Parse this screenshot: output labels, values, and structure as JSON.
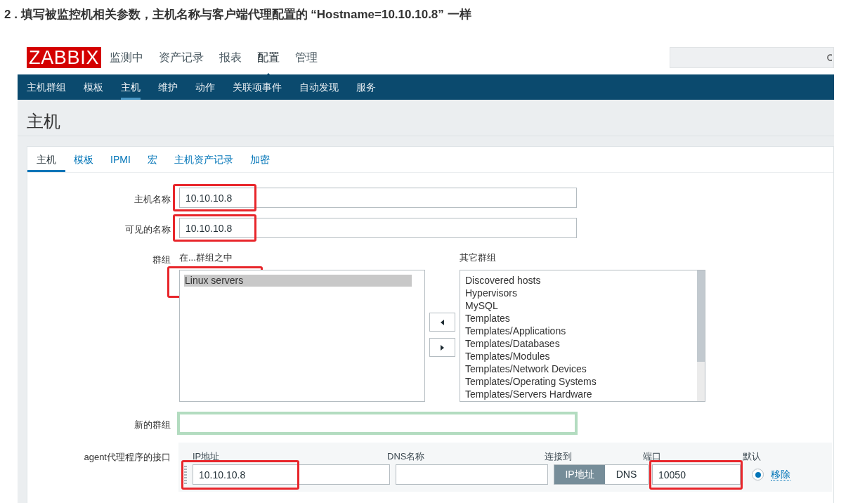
{
  "heading": "2 . 填写被监控机相关参数，主机名称与客户端代理配置的 “Hostname=10.10.10.8” 一样",
  "logo": "ZABBIX",
  "top_menu": [
    {
      "label": "监测中",
      "selected": false
    },
    {
      "label": "资产记录",
      "selected": false
    },
    {
      "label": "报表",
      "selected": false
    },
    {
      "label": "配置",
      "selected": true
    },
    {
      "label": "管理",
      "selected": false
    }
  ],
  "sub_menu": [
    {
      "label": "主机群组",
      "selected": false
    },
    {
      "label": "模板",
      "selected": false
    },
    {
      "label": "主机",
      "selected": true
    },
    {
      "label": "维护",
      "selected": false
    },
    {
      "label": "动作",
      "selected": false
    },
    {
      "label": "关联项事件",
      "selected": false
    },
    {
      "label": "自动发现",
      "selected": false
    },
    {
      "label": "服务",
      "selected": false
    }
  ],
  "page_title": "主机",
  "form_tabs": [
    {
      "label": "主机",
      "selected": true
    },
    {
      "label": "模板",
      "selected": false
    },
    {
      "label": "IPMI",
      "selected": false
    },
    {
      "label": "宏",
      "selected": false
    },
    {
      "label": "主机资产记录",
      "selected": false
    },
    {
      "label": "加密",
      "selected": false
    }
  ],
  "fields": [
    {
      "label": "主机名称",
      "value": "10.10.10.8",
      "highlighted": true
    },
    {
      "label": "可见的名称",
      "value": "10.10.10.8",
      "highlighted": true
    }
  ],
  "groups": {
    "label": "群组",
    "in_label": "在...群组之中",
    "other_label": "其它群组",
    "in_groups": [
      {
        "name": "Linux servers",
        "selected": true,
        "highlighted": true
      }
    ],
    "other_groups": [
      {
        "name": "Discovered hosts",
        "selected": false
      },
      {
        "name": "Hypervisors",
        "selected": false
      },
      {
        "name": "MySQL",
        "selected": false
      },
      {
        "name": "Templates",
        "selected": false
      },
      {
        "name": "Templates/Applications",
        "selected": false
      },
      {
        "name": "Templates/Databases",
        "selected": false
      },
      {
        "name": "Templates/Modules",
        "selected": false
      },
      {
        "name": "Templates/Network Devices",
        "selected": false
      },
      {
        "name": "Templates/Operating Systems",
        "selected": false
      },
      {
        "name": "Templates/Servers Hardware",
        "selected": false
      }
    ]
  },
  "new_group": {
    "label": "新的群组"
  },
  "agent_interface": {
    "label": "agent代理程序的接口",
    "columns": [
      "IP地址",
      "DNS名称",
      "连接到",
      "端口",
      "默认"
    ],
    "ip": {
      "value": "10.10.10.8",
      "highlighted": true
    },
    "connect_options": [
      {
        "label": "IP地址",
        "selected": true
      },
      {
        "label": "DNS",
        "selected": false
      }
    ],
    "port": {
      "value": "10050",
      "highlighted": true
    },
    "default": true,
    "remove_link": "移除"
  }
}
